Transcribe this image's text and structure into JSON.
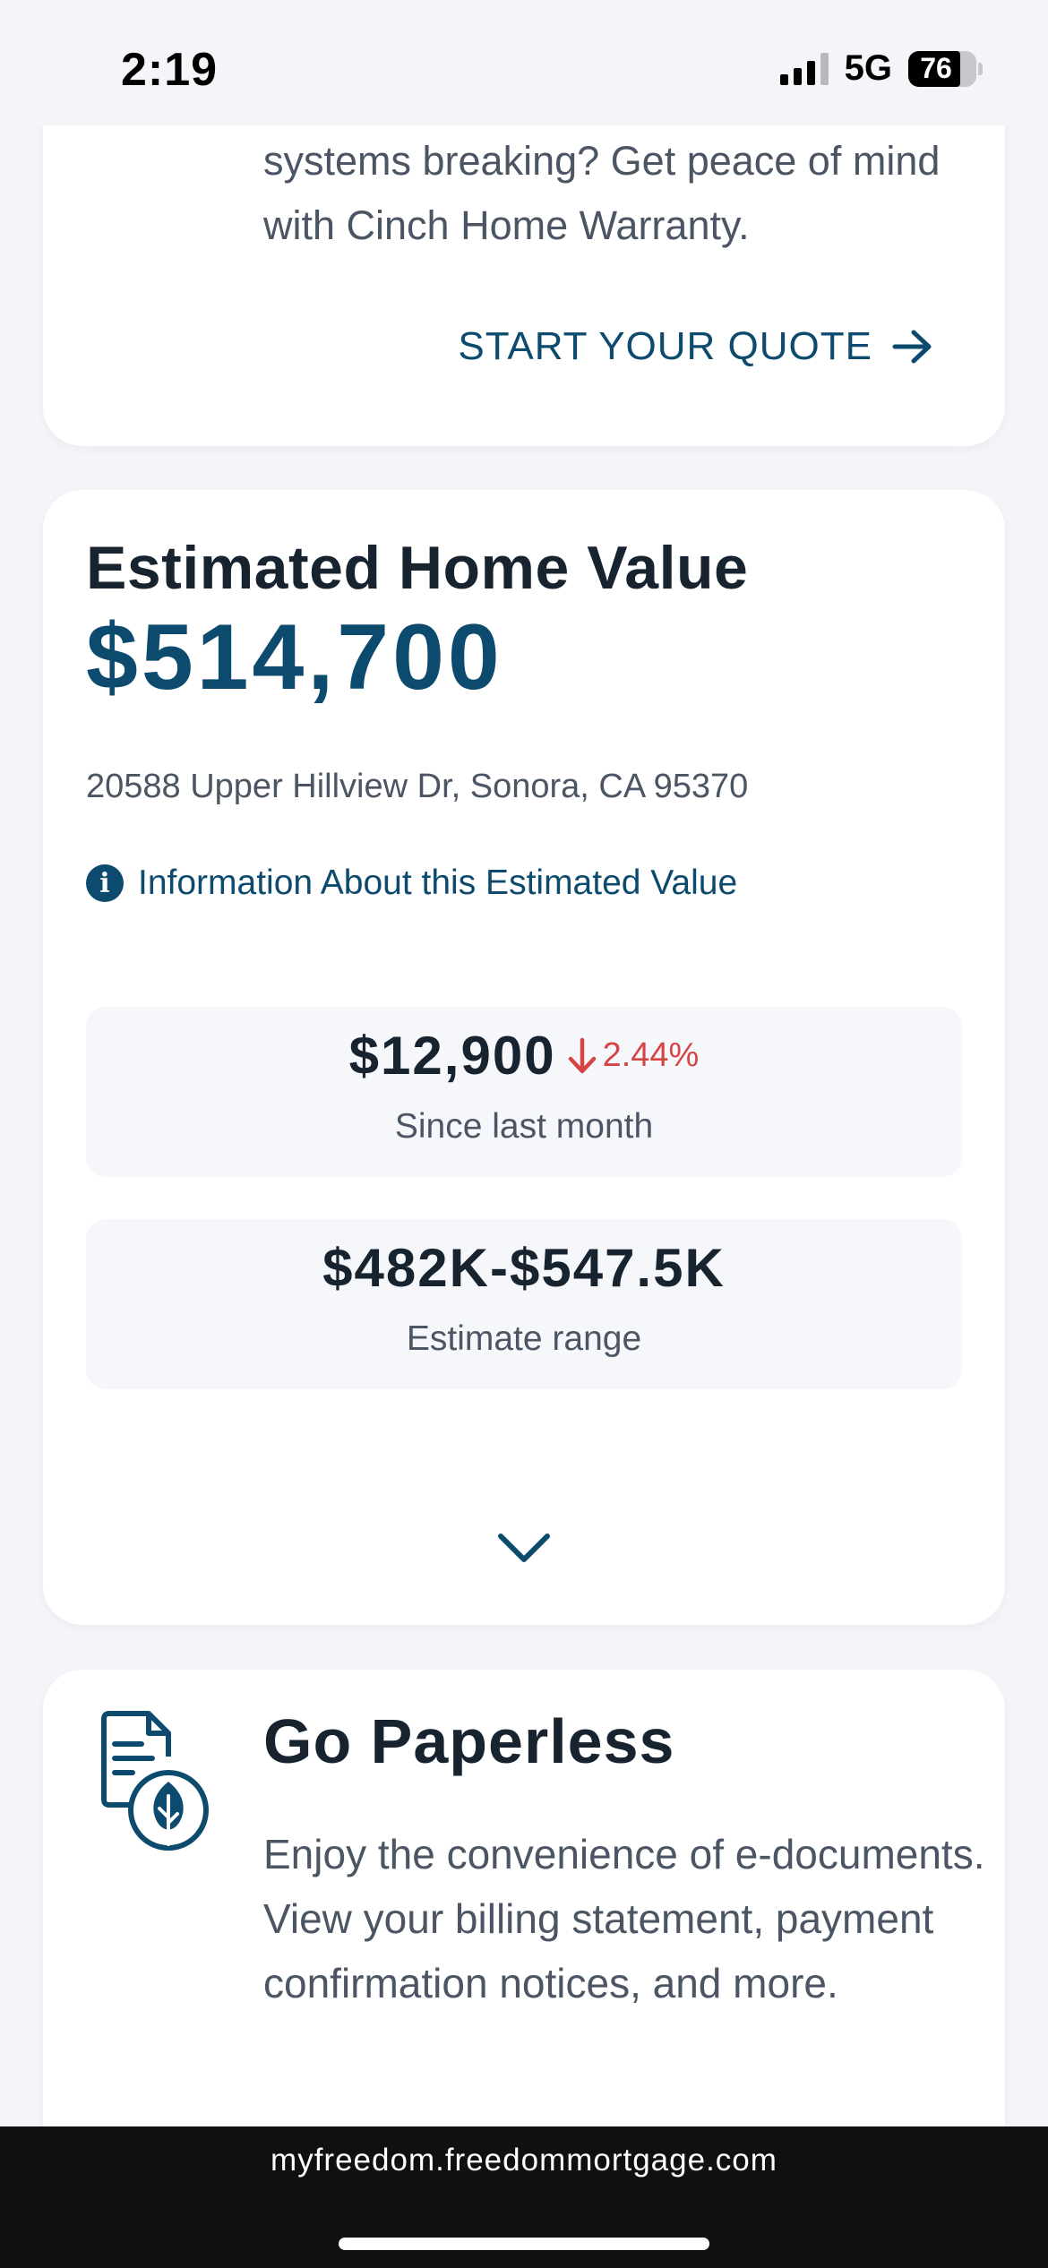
{
  "status_bar": {
    "time": "2:19",
    "network": "5G",
    "battery": "76",
    "battery_level": 0.76
  },
  "warranty_card": {
    "text": "systems breaking? Get peace of mind with Cinch Home Warranty.",
    "cta_label": "START YOUR QUOTE",
    "cta_icon": "arrow-right-icon"
  },
  "home_value_card": {
    "title": "Estimated Home Value",
    "value": "$514,700",
    "address": "20588 Upper Hillview Dr, Sonora, CA 95370",
    "info_link": "Information About this Estimated Value",
    "info_icon": "info-icon",
    "change": {
      "amount": "$12,900",
      "percent": "2.44%",
      "direction": "down",
      "caption": "Since last month"
    },
    "range": {
      "amount": "$482K-$547.5K",
      "caption": "Estimate range"
    },
    "expand_icon": "chevron-down-icon"
  },
  "paperless_card": {
    "title": "Go Paperless",
    "text": "Enjoy the convenience of e-documents. View your billing statement, payment confirmation notices, and more.",
    "icon": "document-leaf-icon"
  },
  "browser": {
    "url": "myfreedom.freedommortgage.com"
  },
  "colors": {
    "brand_blue": "#0d4b6e",
    "negative_red": "#d64545",
    "background": "#f4f5f9",
    "text_dark": "#182330",
    "text_muted": "#4b5563"
  }
}
